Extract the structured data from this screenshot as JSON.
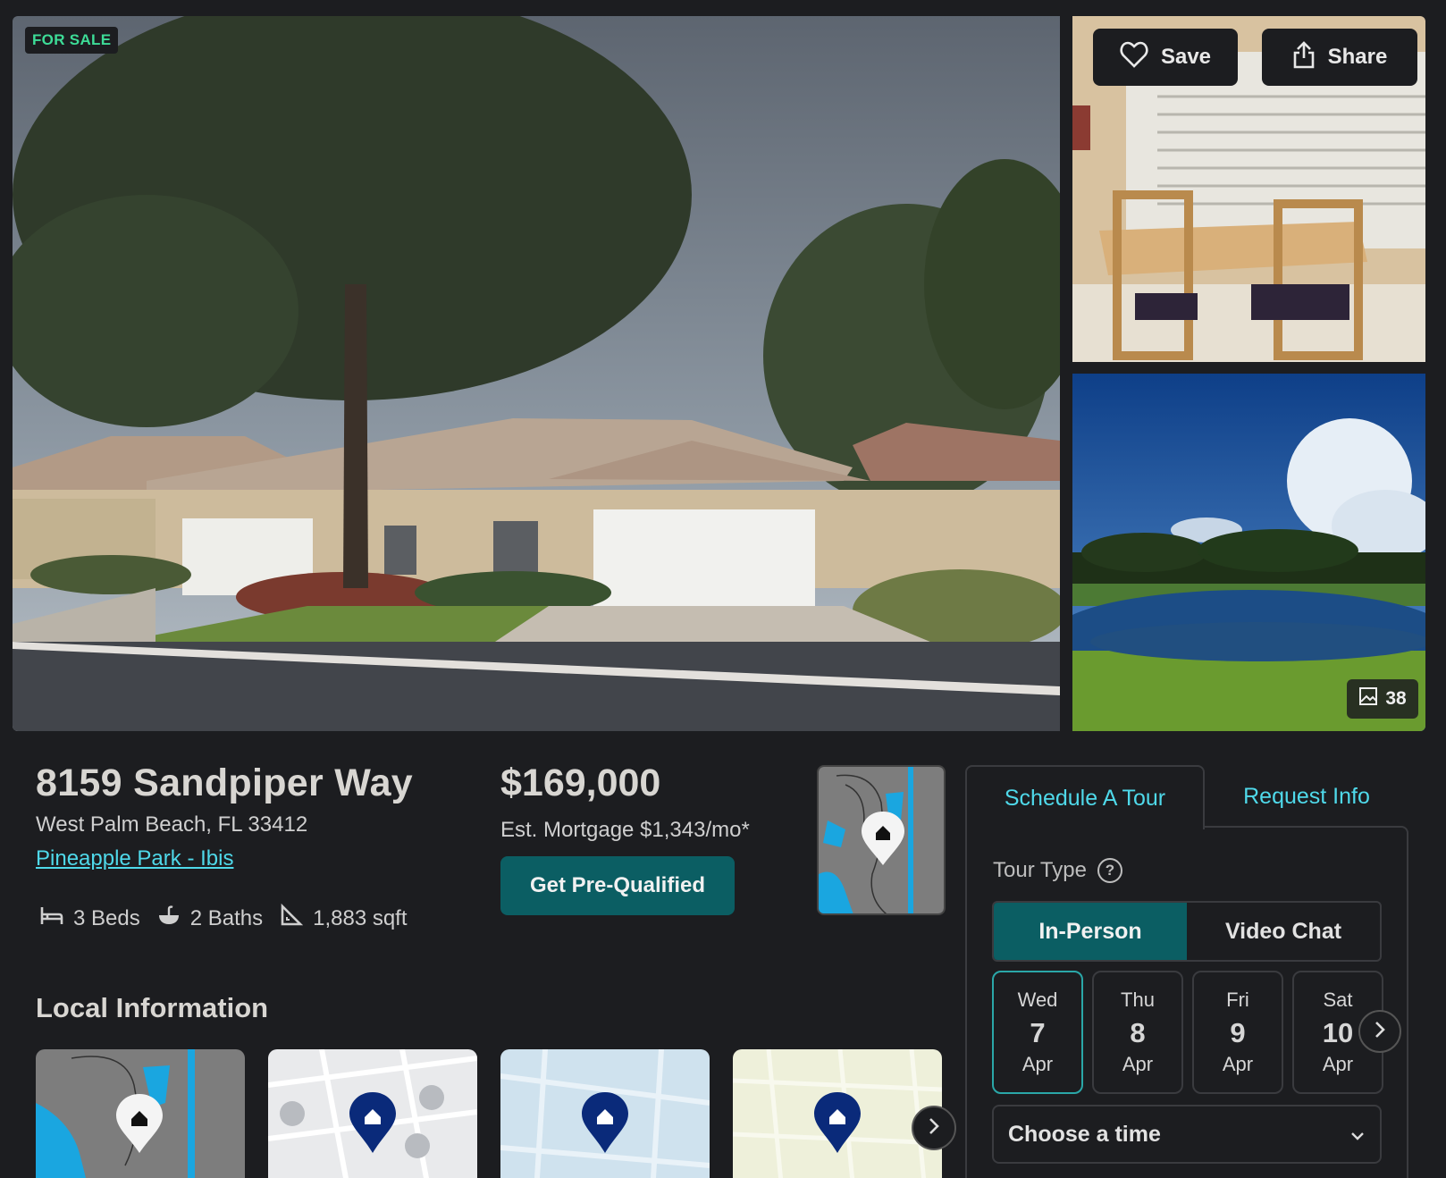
{
  "gallery": {
    "badge": "FOR SALE",
    "save_label": "Save",
    "share_label": "Share",
    "photo_count": "38"
  },
  "listing": {
    "address": "8159 Sandpiper Way",
    "city_state_zip": "West Palm Beach, FL 33412",
    "neighborhood": "Pineapple Park - Ibis",
    "beds": "3 Beds",
    "baths": "2 Baths",
    "sqft": "1,883 sqft",
    "price": "$169,000",
    "mortgage": "Est. Mortgage $1,343/mo*",
    "prequal_label": "Get Pre-Qualified"
  },
  "local": {
    "heading": "Local Information"
  },
  "tour": {
    "tabs": [
      {
        "label": "Schedule A Tour"
      },
      {
        "label": "Request Info"
      }
    ],
    "type_label": "Tour Type",
    "help_glyph": "?",
    "types": [
      {
        "label": "In-Person"
      },
      {
        "label": "Video Chat"
      }
    ],
    "dates": [
      {
        "dow": "Wed",
        "day": "7",
        "month": "Apr"
      },
      {
        "dow": "Thu",
        "day": "8",
        "month": "Apr"
      },
      {
        "dow": "Fri",
        "day": "9",
        "month": "Apr"
      },
      {
        "dow": "Sat",
        "day": "10",
        "month": "Apr"
      }
    ],
    "time_placeholder": "Choose a time"
  },
  "colors": {
    "background": "#1c1d20",
    "accent_teal": "#0b5e63",
    "link_cyan": "#4fd9ea",
    "badge_green": "#3ddc97"
  },
  "icons": [
    "heart-icon",
    "share-icon",
    "image-icon",
    "bed-icon",
    "bath-icon",
    "sqft-icon",
    "home-pin-icon",
    "chevron-right-icon",
    "chevron-down-icon",
    "help-icon"
  ]
}
